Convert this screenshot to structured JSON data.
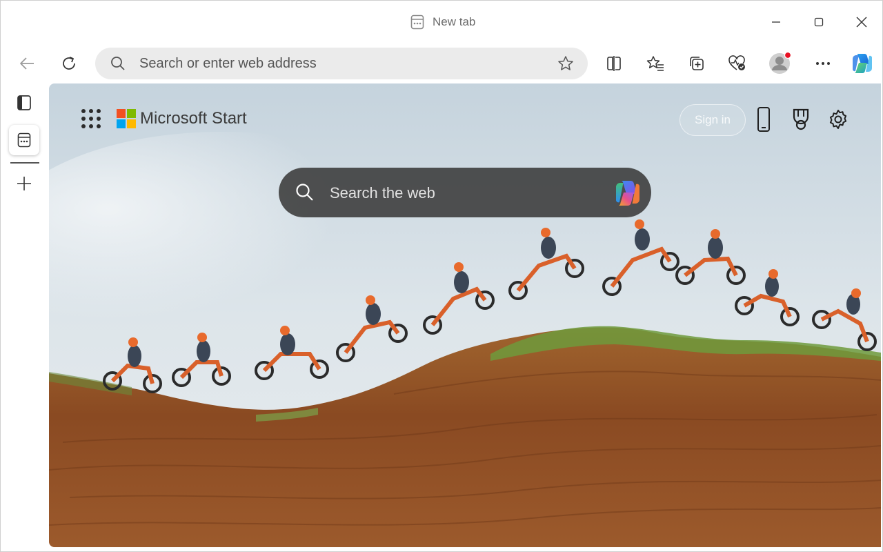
{
  "window": {
    "title": "New tab",
    "controls": [
      "minimize-icon",
      "maximize-icon",
      "close-icon"
    ]
  },
  "toolbar": {
    "address_placeholder": "Search or enter web address",
    "icons": [
      "back-arrow-icon",
      "refresh-icon",
      "search-icon",
      "favorite-star-icon",
      "split-screen-icon",
      "favorites-icon",
      "collections-icon",
      "browser-essentials-icon",
      "profile-avatar-icon",
      "more-options-icon",
      "copilot-icon"
    ]
  },
  "sidebar": {
    "icons": [
      "tab-actions-icon",
      "new-tab-page-icon",
      "new-tab-plus-icon"
    ]
  },
  "page": {
    "brand": "Microsoft Start",
    "signin_label": "Sign in",
    "search_placeholder": "Search the web",
    "icons": [
      "app-launcher-icon",
      "microsoft-logo-icon",
      "phone-icon",
      "rewards-trophy-icon",
      "settings-gear-icon",
      "copilot-icon"
    ]
  },
  "colors": {
    "accent_blue": "#0078d4",
    "profile_dot": "#e81123",
    "sky_top": "#c9d6df",
    "dirt": "#8a4a22"
  }
}
